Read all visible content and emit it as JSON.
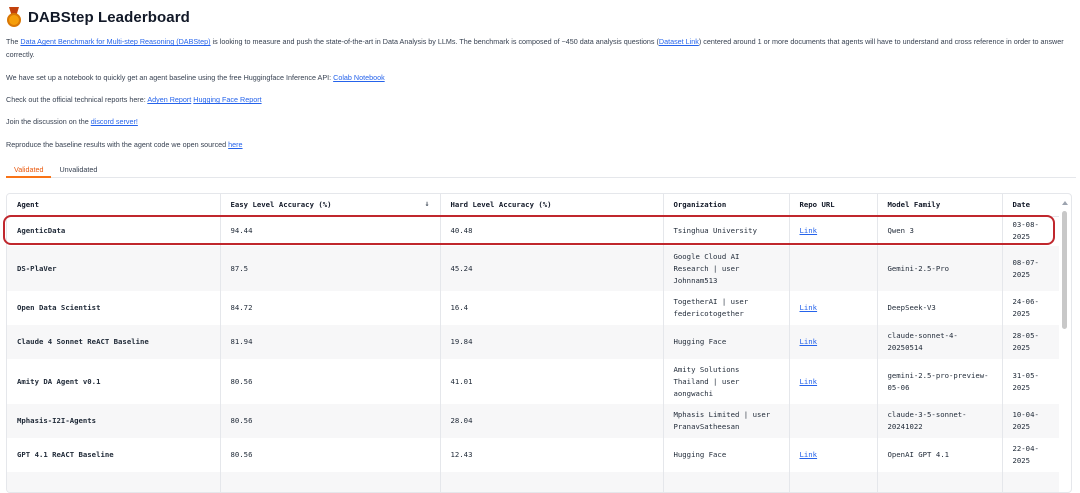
{
  "page": {
    "title": "DABStep Leaderboard"
  },
  "intro": {
    "p1_pre": "The ",
    "p1_link1": "Data Agent Benchmark for Multi-step Reasoning (DABStep)",
    "p1_mid": " is looking to measure and push the state-of-the-art in Data Analysis by LLMs. The benchmark is composed of ~450 data analysis questions (",
    "p1_link2": "Dataset Link",
    "p1_post": ") centered around 1 or more documents that agents will have to understand and cross reference in order to answer correctly.",
    "p2_pre": "We have set up a notebook to quickly get an agent baseline using the free Huggingface Inference API: ",
    "p2_link": "Colab Notebook",
    "p3_pre": "Check out the official technical reports here: ",
    "p3_link1": "Adyen Report",
    "p3_link2": "Hugging Face Report",
    "p4_pre": "Join the discussion on the ",
    "p4_link": "discord server!",
    "p5_pre": "Reproduce the baseline results with the agent code we open sourced ",
    "p5_link": "here"
  },
  "tabs": [
    {
      "label": "Validated",
      "active": true
    },
    {
      "label": "Unvalidated",
      "active": false
    }
  ],
  "table": {
    "columns": [
      "Agent",
      "Easy Level Accuracy (%)",
      "Hard Level Accuracy (%)",
      "Organization",
      "Repo URL",
      "Model Family",
      "Date"
    ],
    "sort_icon": "↓",
    "rows": [
      {
        "agent": "AgenticData",
        "easy": "94.44",
        "hard": "40.48",
        "org": [
          "Tsinghua University"
        ],
        "repo": "Link",
        "model": [
          "Qwen 3"
        ],
        "date": [
          "03-08-",
          "2025"
        ]
      },
      {
        "agent": "DS-PlaVer",
        "easy": "87.5",
        "hard": "45.24",
        "org": [
          "Google Cloud AI",
          "Research | user",
          "Johnnam513"
        ],
        "repo": "",
        "model": [
          "Gemini-2.5-Pro"
        ],
        "date": [
          "08-07-",
          "2025"
        ]
      },
      {
        "agent": "Open Data Scientist",
        "easy": "84.72",
        "hard": "16.4",
        "org": [
          "TogetherAI | user",
          "federicotogether"
        ],
        "repo": "Link",
        "model": [
          "DeepSeek-V3"
        ],
        "date": [
          "24-06-",
          "2025"
        ]
      },
      {
        "agent": "Claude 4 Sonnet ReACT Baseline",
        "easy": "81.94",
        "hard": "19.84",
        "org": [
          "Hugging Face"
        ],
        "repo": "Link",
        "model": [
          "claude-sonnet-4-",
          "20250514"
        ],
        "date": [
          "28-05-",
          "2025"
        ]
      },
      {
        "agent": "Amity DA Agent v0.1",
        "easy": "80.56",
        "hard": "41.01",
        "org": [
          "Amity Solutions",
          "Thailand | user",
          "aongwachi"
        ],
        "repo": "Link",
        "model": [
          "gemini-2.5-pro-preview-",
          "05-06"
        ],
        "date": [
          "31-05-",
          "2025"
        ]
      },
      {
        "agent": "Mphasis-I2I-Agents",
        "easy": "80.56",
        "hard": "28.04",
        "org": [
          "Mphasis Limited | user",
          "PranavSatheesan"
        ],
        "repo": "",
        "model": [
          "claude-3-5-sonnet-",
          "20241022"
        ],
        "date": [
          "10-04-",
          "2025"
        ]
      },
      {
        "agent": "GPT 4.1 ReACT Baseline",
        "easy": "80.56",
        "hard": "12.43",
        "org": [
          "Hugging Face"
        ],
        "repo": "Link",
        "model": [
          "OpenAI GPT 4.1"
        ],
        "date": [
          "22-04-",
          "2025"
        ]
      }
    ]
  },
  "colors": {
    "accent": "#f97316",
    "link": "#2563eb",
    "highlight": "#c0272d"
  }
}
